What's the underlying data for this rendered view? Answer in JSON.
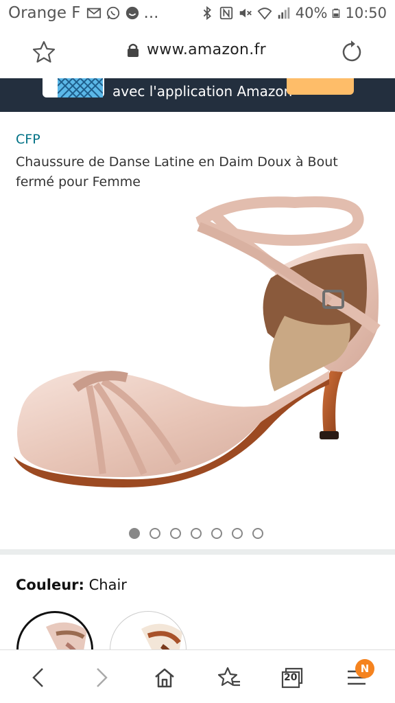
{
  "status_bar": {
    "carrier": "Orange F",
    "notif_more": "...",
    "battery": "40%",
    "time": "10:50",
    "icons": [
      "gmail-icon",
      "whatsapp-icon",
      "app-icon",
      "bluetooth-icon",
      "nfc-icon",
      "mute-icon",
      "wifi-icon",
      "signal-icon",
      "battery-icon"
    ]
  },
  "browser": {
    "url": "www.amazon.fr",
    "tab_count": "20",
    "notification_badge": "N"
  },
  "banner": {
    "text": "avec l'application Amazon"
  },
  "product": {
    "brand": "CFP",
    "title": "Chaussure de Danse Latine en Daim Doux à Bout fermé pour Femme",
    "image_count": 7,
    "active_image": 1,
    "color_label": "Couleur:",
    "color_value": "Chair"
  },
  "colors": {
    "banner_bg": "#232f3e",
    "link": "#007185",
    "badge": "#f5831f",
    "shoe": "#e8c9bd"
  }
}
